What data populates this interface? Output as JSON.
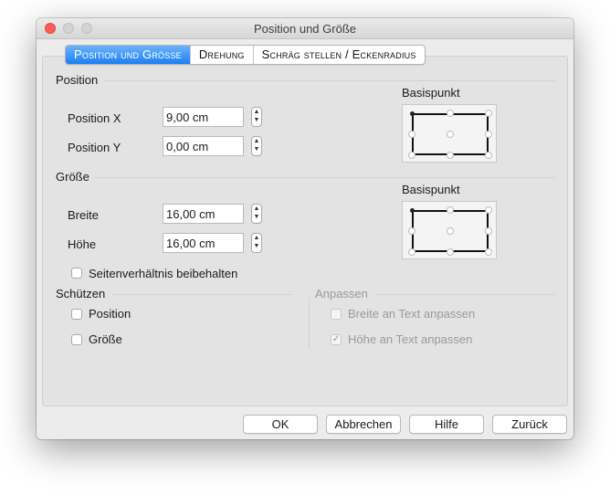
{
  "window": {
    "title": "Position und Größe"
  },
  "tabs": [
    {
      "label": "Position und Grösse",
      "active": true
    },
    {
      "label": "Drehung",
      "active": false
    },
    {
      "label": "Schräg stellen / Eckenradius",
      "active": false
    }
  ],
  "position": {
    "heading": "Position",
    "x_label": "Position X",
    "x_value": "9,00 cm",
    "y_label": "Position Y",
    "y_value": "0,00 cm",
    "base_label": "Basispunkt"
  },
  "size": {
    "heading": "Größe",
    "width_label": "Breite",
    "width_value": "16,00 cm",
    "height_label": "Höhe",
    "height_value": "16,00 cm",
    "base_label": "Basispunkt",
    "keep_ratio_label": "Seitenverhältnis beibehalten",
    "keep_ratio_checked": false
  },
  "protect": {
    "heading": "Schützen",
    "position_label": "Position",
    "position_checked": false,
    "size_label": "Größe",
    "size_checked": false
  },
  "adapt": {
    "heading": "Anpassen",
    "width_label": "Breite an Text anpassen",
    "width_checked": false,
    "height_label": "Höhe an Text anpassen",
    "height_checked": true,
    "check_glyph": "✓"
  },
  "buttons": {
    "ok": "OK",
    "cancel": "Abbrechen",
    "help": "Hilfe",
    "reset": "Zurück"
  },
  "icons": {
    "stepper": "up-down-arrows-icon",
    "selected_point": "top-left"
  },
  "colors": {
    "accent": "#1b7ff5",
    "close": "#fc5f57"
  }
}
